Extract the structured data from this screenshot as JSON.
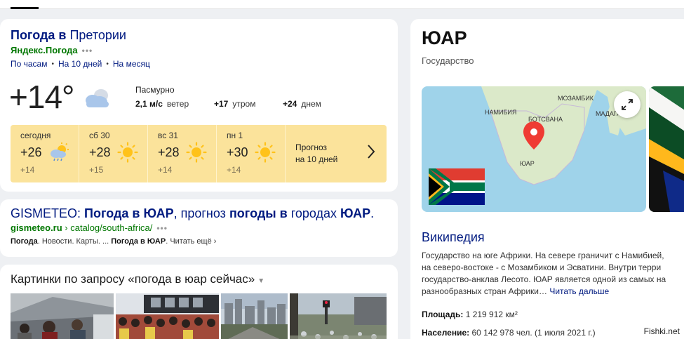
{
  "weather": {
    "title_bold": "Погода в",
    "title_city": " Претории",
    "source": "Яндекс.Погода",
    "nav": [
      "По часам",
      "На 10 дней",
      "На месяц"
    ],
    "temp": "+14°",
    "condition": "Пасмурно",
    "wind_value": "2,1 м/с",
    "wind_label": "ветер",
    "morning_value": "+17",
    "morning_label": "утром",
    "day_value": "+24",
    "day_label": "днем",
    "days": [
      {
        "name": "сегодня",
        "max": "+26",
        "min": "+14",
        "icon": "sun-cloud-rain-icon"
      },
      {
        "name": "сб 30",
        "max": "+28",
        "min": "+15",
        "icon": "sun-icon"
      },
      {
        "name": "вс 31",
        "max": "+28",
        "min": "+14",
        "icon": "sun-icon"
      },
      {
        "name": "пн 1",
        "max": "+30",
        "min": "+14",
        "icon": "sun-icon"
      }
    ],
    "forecast_line1": "Прогноз",
    "forecast_line2": "на 10 дней"
  },
  "gismeteo": {
    "t1": "GISMETEO: ",
    "t2": "Погода в ЮАР",
    "t3": ", прогноз ",
    "t4": "погоды в",
    "t5": " городах ",
    "t6": "ЮАР",
    "t7": ".",
    "url_domain": "gismeteo.ru",
    "url_path": " › catalog/south-africa/",
    "snip_b1": "Погода",
    "snip_t1": ". Новости. Карты. ... ",
    "snip_b2": "Погода в ЮАР",
    "snip_t2": ". Читать ещё ›"
  },
  "images": {
    "title": "Картинки по запросу «погода в юар сейчас»"
  },
  "kp": {
    "title": "ЮАР",
    "subtitle": "Государство",
    "map_labels": {
      "namibia": "НАМИБИЯ",
      "botswana": "БОТСВАНА",
      "mozambique": "МОЗАМБИК",
      "madagascar": "МАДАГАС",
      "sa": "ЮАР"
    },
    "wiki_title": "Википедия",
    "desc_lines": [
      "Государство на юге Африки. На севере граничит с Намибией,",
      "на северо-востоке - с Мозамбиком и Эсватини. Внутри терри",
      "государство-анклав Лесото. ЮАР является одной из самых на",
      "разнообразных стран Африки… "
    ],
    "read_more": "Читать дальше",
    "area_label": "Площадь:",
    "area_value": " 1 219 912 км²",
    "pop_label": "Население:",
    "pop_value": " 60 142 978 чел. (1 июля 2021 г.)"
  },
  "watermark": "Fishki.net",
  "colors": {
    "link": "#001a80",
    "url": "#007700",
    "forecast_bg": "#fbe39b",
    "map_water": "#9fd3ea",
    "map_land": "#dbe9c9"
  }
}
